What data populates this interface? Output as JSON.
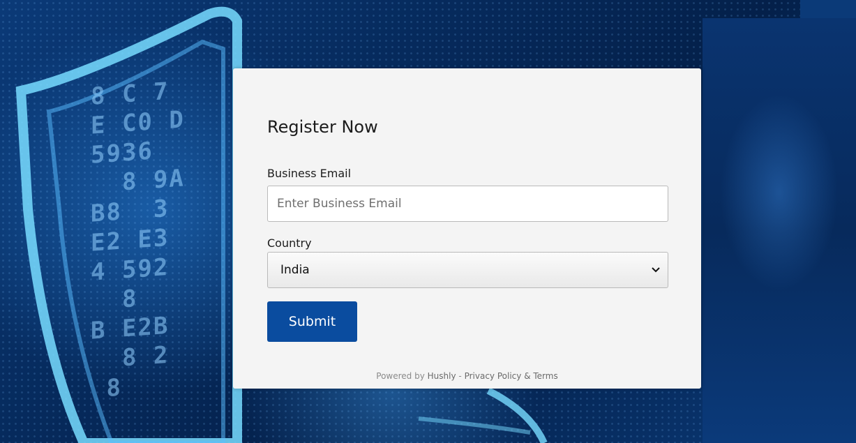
{
  "form": {
    "title": "Register Now",
    "email_label": "Business Email",
    "email_placeholder": "Enter Business Email",
    "email_value": "",
    "country_label": "Country",
    "country_selected": "India",
    "submit_label": "Submit"
  },
  "footer": {
    "powered_by": "Powered by",
    "brand": "Hushly",
    "separator": "-",
    "privacy": "Privacy Policy",
    "amp": "&",
    "terms": "Terms"
  },
  "background": {
    "code_glyphs": "8 C 7\nE C0 D\n5936\n  8 9A\nB8  3\nE2 E3\n4 592\n  8\nB E2B\n  8 2\n 8\n"
  },
  "colors": {
    "submit_bg": "#0a4c9f",
    "card_bg": "#f4f4f4",
    "page_bg": "#06244f"
  }
}
